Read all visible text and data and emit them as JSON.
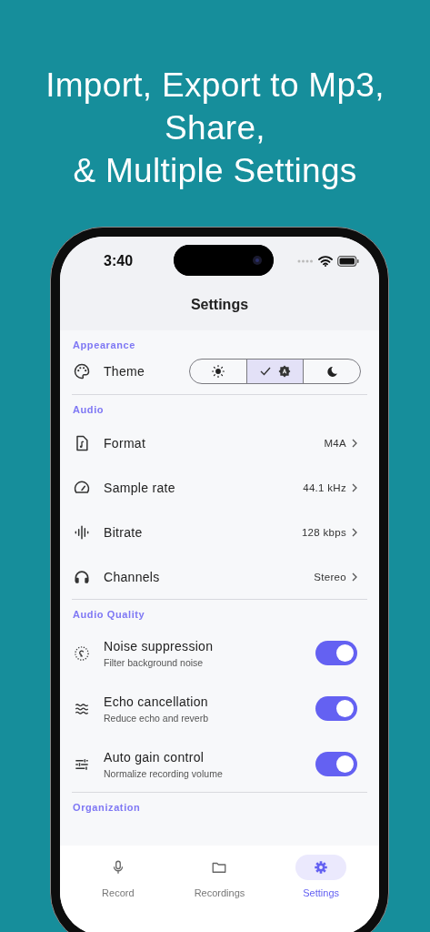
{
  "headline": [
    "Import, Export to Mp3,",
    "Share,",
    "& Multiple Settings"
  ],
  "status_bar": {
    "time": "3:40"
  },
  "header": {
    "title": "Settings"
  },
  "sections": [
    {
      "title": "Appearance",
      "items": [
        {
          "kind": "theme",
          "label": "Theme",
          "options": [
            {
              "kind": "light",
              "selected": false
            },
            {
              "kind": "auto",
              "selected": true
            },
            {
              "kind": "dark",
              "selected": false
            }
          ]
        }
      ]
    },
    {
      "title": "Audio",
      "items": [
        {
          "kind": "value",
          "label": "Format",
          "value": "M4A"
        },
        {
          "kind": "value",
          "label": "Sample rate",
          "value": "44.1 kHz"
        },
        {
          "kind": "value",
          "label": "Bitrate",
          "value": "128 kbps"
        },
        {
          "kind": "value",
          "label": "Channels",
          "value": "Stereo"
        }
      ]
    },
    {
      "title": "Audio Quality",
      "items": [
        {
          "kind": "toggle",
          "label": "Noise suppression",
          "description": "Filter background noise",
          "on": true
        },
        {
          "kind": "toggle",
          "label": "Echo cancellation",
          "description": "Reduce echo and reverb",
          "on": true
        },
        {
          "kind": "toggle",
          "label": "Auto gain control",
          "description": "Normalize recording volume",
          "on": true
        }
      ]
    },
    {
      "title": "Organization"
    }
  ],
  "nav": [
    {
      "label": "Record",
      "selected": false
    },
    {
      "label": "Recordings",
      "selected": false
    },
    {
      "label": "Settings",
      "selected": true
    }
  ]
}
